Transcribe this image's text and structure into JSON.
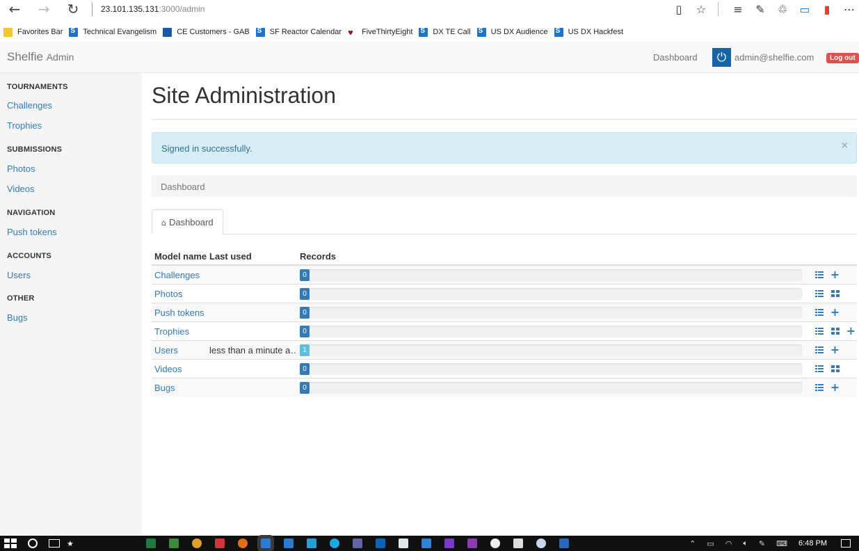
{
  "browser": {
    "address_host": "23.101.135.131",
    "address_rest": ":3000/admin",
    "favorites": [
      {
        "label": "Favorites Bar",
        "icon": "folder-icon"
      },
      {
        "label": "Technical Evangelism",
        "icon": "sharepoint-icon"
      },
      {
        "label": "CE Customers - GAB",
        "icon": "ce-icon"
      },
      {
        "label": "SF Reactor Calendar",
        "icon": "sharepoint-icon"
      },
      {
        "label": "FiveThirtyEight",
        "icon": "fox-icon"
      },
      {
        "label": "DX TE Call",
        "icon": "sharepoint-icon"
      },
      {
        "label": "US DX Audience",
        "icon": "sharepoint-icon"
      },
      {
        "label": "US DX Hackfest",
        "icon": "sharepoint-icon"
      }
    ]
  },
  "header": {
    "brand": "Shelfie",
    "brand_sub": "Admin",
    "nav_dashboard": "Dashboard",
    "user_email": "admin@shelfie.com",
    "logout": "Log out"
  },
  "sidebar": {
    "groups": [
      {
        "heading": "TOURNAMENTS",
        "items": [
          "Challenges",
          "Trophies"
        ]
      },
      {
        "heading": "SUBMISSIONS",
        "items": [
          "Photos",
          "Videos"
        ]
      },
      {
        "heading": "NAVIGATION",
        "items": [
          "Push tokens"
        ]
      },
      {
        "heading": "ACCOUNTS",
        "items": [
          "Users"
        ]
      },
      {
        "heading": "OTHER",
        "items": [
          "Bugs"
        ]
      }
    ]
  },
  "main": {
    "title": "Site Administration",
    "alert": "Signed in successfully.",
    "alert_close": "×",
    "breadcrumb": "Dashboard",
    "tab": "Dashboard",
    "columns": [
      "Model name",
      "Last used",
      "Records"
    ],
    "rows": [
      {
        "name": "Challenges",
        "last_used": "",
        "records": "0",
        "actions": [
          "list",
          "add"
        ]
      },
      {
        "name": "Photos",
        "last_used": "",
        "records": "0",
        "actions": [
          "list",
          "grid"
        ]
      },
      {
        "name": "Push tokens",
        "last_used": "",
        "records": "0",
        "actions": [
          "list",
          "add"
        ]
      },
      {
        "name": "Trophies",
        "last_used": "",
        "records": "0",
        "actions": [
          "list",
          "grid",
          "add"
        ]
      },
      {
        "name": "Users",
        "last_used": "less than a minute a…",
        "records": "1",
        "actions": [
          "list",
          "add"
        ]
      },
      {
        "name": "Videos",
        "last_used": "",
        "records": "0",
        "actions": [
          "list",
          "grid"
        ]
      },
      {
        "name": "Bugs",
        "last_used": "",
        "records": "0",
        "actions": [
          "list",
          "add"
        ]
      }
    ]
  },
  "taskbar": {
    "time": "6:48 PM"
  },
  "colors": {
    "link": "#337ab7",
    "alert_bg": "#d9edf7",
    "logout": "#d9534f",
    "badge": "#337ab7",
    "badge_info": "#5bc0de"
  }
}
